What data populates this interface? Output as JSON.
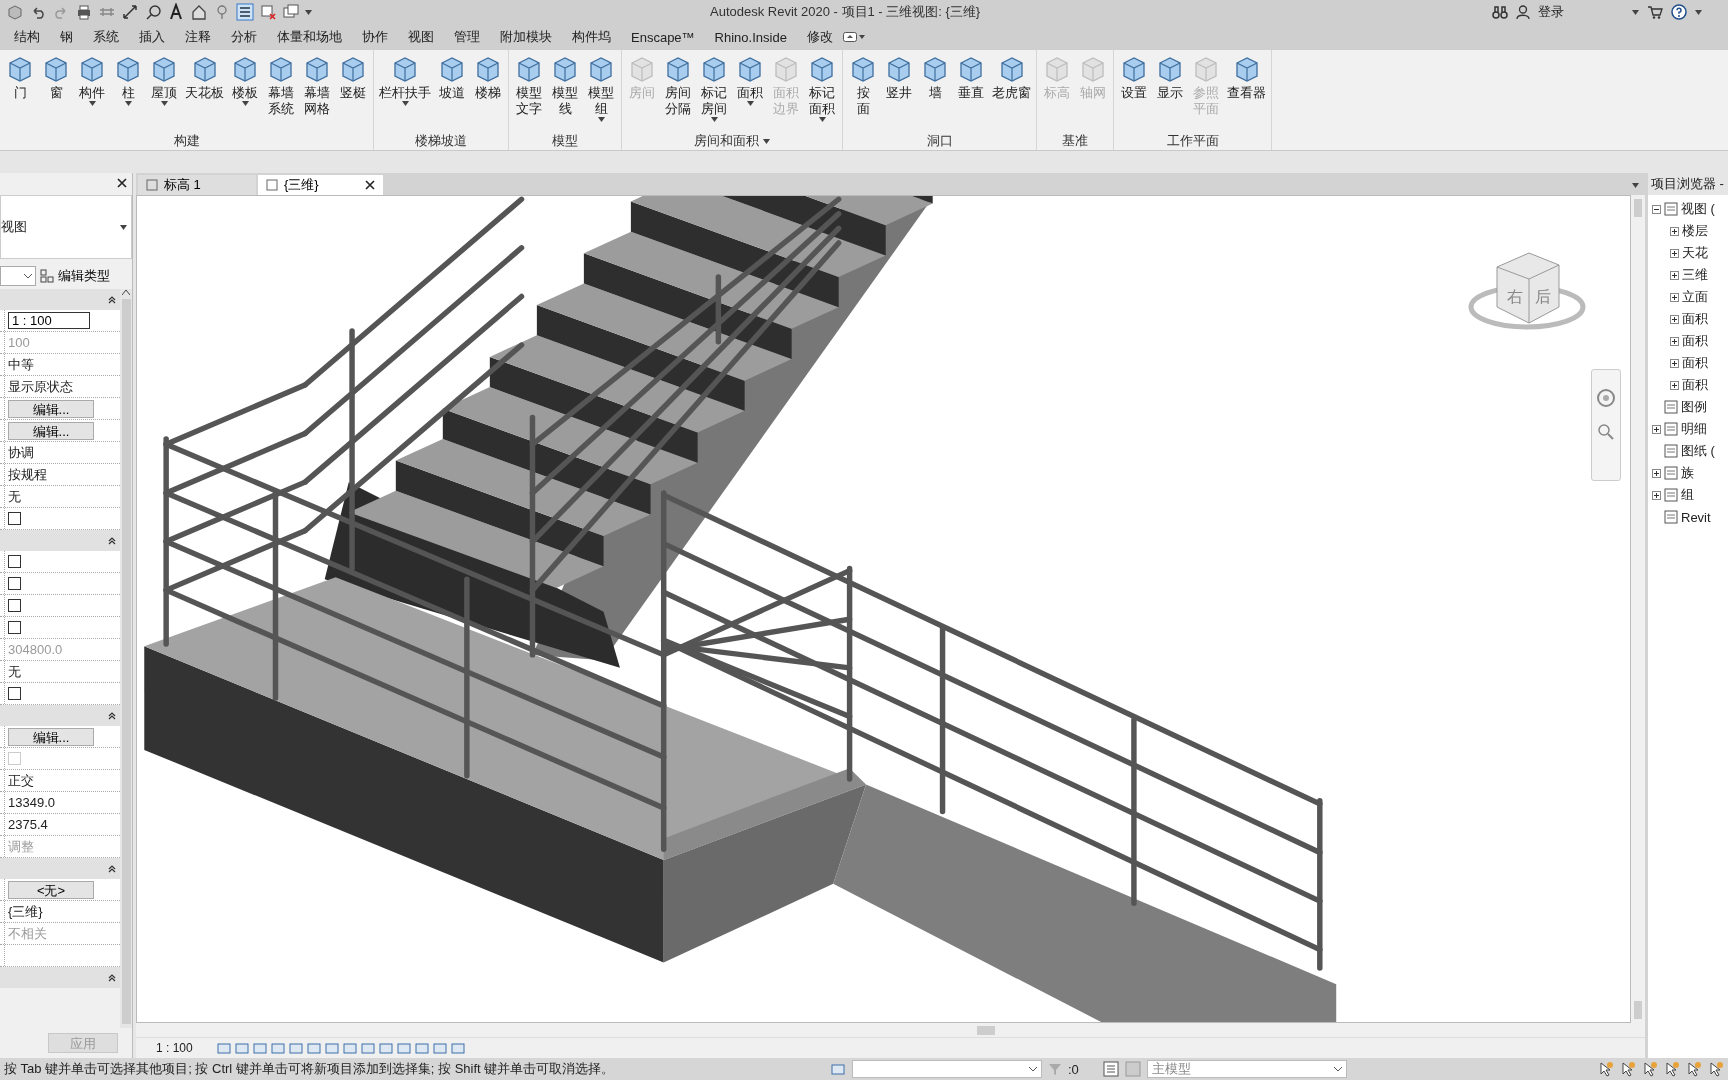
{
  "window": {
    "title": "Autodesk Revit 2020 - 项目1 - 三维视图: {三维}"
  },
  "account": {
    "label": "登录"
  },
  "ribbon_tabs": [
    {
      "label": "结构",
      "selected": false
    },
    {
      "label": "钢",
      "selected": false
    },
    {
      "label": "系统",
      "selected": false
    },
    {
      "label": "插入",
      "selected": false
    },
    {
      "label": "注释",
      "selected": false
    },
    {
      "label": "分析",
      "selected": false
    },
    {
      "label": "体量和场地",
      "selected": false
    },
    {
      "label": "协作",
      "selected": false
    },
    {
      "label": "视图",
      "selected": false
    },
    {
      "label": "管理",
      "selected": false
    },
    {
      "label": "附加模块",
      "selected": false
    },
    {
      "label": "构件坞",
      "selected": false
    },
    {
      "label": "Enscape™",
      "selected": false
    },
    {
      "label": "Rhino.Inside",
      "selected": false
    },
    {
      "label": "修改",
      "selected": false
    }
  ],
  "ribbon_panels": [
    {
      "title": "构建",
      "title_dropdown": false,
      "buttons": [
        {
          "lines": [
            "门"
          ],
          "disabled": false,
          "dropdown": false
        },
        {
          "lines": [
            "窗"
          ],
          "disabled": false,
          "dropdown": false
        },
        {
          "lines": [
            "构件"
          ],
          "disabled": false,
          "dropdown": true
        },
        {
          "lines": [
            "柱"
          ],
          "disabled": false,
          "dropdown": true
        },
        {
          "lines": [
            "屋顶"
          ],
          "disabled": false,
          "dropdown": true
        },
        {
          "lines": [
            "天花板"
          ],
          "disabled": false,
          "dropdown": false
        },
        {
          "lines": [
            "楼板"
          ],
          "disabled": false,
          "dropdown": true
        },
        {
          "lines": [
            "幕墙",
            "系统"
          ],
          "disabled": false,
          "dropdown": false
        },
        {
          "lines": [
            "幕墙",
            "网格"
          ],
          "disabled": false,
          "dropdown": false
        },
        {
          "lines": [
            "竖梃"
          ],
          "disabled": false,
          "dropdown": false
        }
      ]
    },
    {
      "title": "楼梯坡道",
      "title_dropdown": false,
      "buttons": [
        {
          "lines": [
            "栏杆扶手"
          ],
          "disabled": false,
          "dropdown": true
        },
        {
          "lines": [
            "坡道"
          ],
          "disabled": false,
          "dropdown": false
        },
        {
          "lines": [
            "楼梯"
          ],
          "disabled": false,
          "dropdown": false
        }
      ]
    },
    {
      "title": "模型",
      "title_dropdown": false,
      "buttons": [
        {
          "lines": [
            "模型",
            "文字"
          ],
          "disabled": false,
          "dropdown": false
        },
        {
          "lines": [
            "模型",
            "线"
          ],
          "disabled": false,
          "dropdown": false
        },
        {
          "lines": [
            "模型",
            "组"
          ],
          "disabled": false,
          "dropdown": true
        }
      ]
    },
    {
      "title": "房间和面积",
      "title_dropdown": true,
      "buttons": [
        {
          "lines": [
            "房间"
          ],
          "disabled": true,
          "dropdown": false
        },
        {
          "lines": [
            "房间",
            "分隔"
          ],
          "disabled": false,
          "dropdown": false
        },
        {
          "lines": [
            "标记",
            "房间"
          ],
          "disabled": false,
          "dropdown": true
        },
        {
          "lines": [
            "面积"
          ],
          "disabled": false,
          "dropdown": true
        },
        {
          "lines": [
            "面积",
            "边界"
          ],
          "disabled": true,
          "dropdown": false
        },
        {
          "lines": [
            "标记",
            "面积"
          ],
          "disabled": false,
          "dropdown": true
        }
      ]
    },
    {
      "title": "洞口",
      "title_dropdown": false,
      "buttons": [
        {
          "lines": [
            "按",
            "面"
          ],
          "disabled": false,
          "dropdown": false
        },
        {
          "lines": [
            "竖井"
          ],
          "disabled": false,
          "dropdown": false
        },
        {
          "lines": [
            "墙"
          ],
          "disabled": false,
          "dropdown": false
        },
        {
          "lines": [
            "垂直"
          ],
          "disabled": false,
          "dropdown": false
        },
        {
          "lines": [
            "老虎窗"
          ],
          "disabled": false,
          "dropdown": false
        }
      ]
    },
    {
      "title": "基准",
      "title_dropdown": false,
      "buttons": [
        {
          "lines": [
            "标高"
          ],
          "disabled": true,
          "dropdown": false
        },
        {
          "lines": [
            "轴网"
          ],
          "disabled": true,
          "dropdown": false
        }
      ]
    },
    {
      "title": "工作平面",
      "title_dropdown": false,
      "buttons": [
        {
          "lines": [
            "设置"
          ],
          "disabled": false,
          "dropdown": false
        },
        {
          "lines": [
            "显示"
          ],
          "disabled": false,
          "dropdown": false
        },
        {
          "lines": [
            "参照",
            "平面"
          ],
          "disabled": true,
          "dropdown": false
        },
        {
          "lines": [
            "查看器"
          ],
          "disabled": false,
          "dropdown": false
        }
      ]
    }
  ],
  "view_tabs": [
    {
      "label": "标高 1",
      "selected": false
    },
    {
      "label": "{三维}",
      "selected": true
    }
  ],
  "properties": {
    "type_name": "视图",
    "edit_type": "编辑类型",
    "apply": "应用",
    "rows": [
      {
        "kind": "section"
      },
      {
        "kind": "field",
        "value": "1 : 100"
      },
      {
        "kind": "text",
        "value": "100",
        "disabled": true
      },
      {
        "kind": "text",
        "value": "中等",
        "disabled": false
      },
      {
        "kind": "text",
        "value": "显示原状态",
        "disabled": false
      },
      {
        "kind": "button",
        "value": "编辑..."
      },
      {
        "kind": "button",
        "value": "编辑..."
      },
      {
        "kind": "text",
        "value": "协调",
        "disabled": false
      },
      {
        "kind": "text",
        "value": "按规程",
        "disabled": false
      },
      {
        "kind": "text",
        "value": "无",
        "disabled": false
      },
      {
        "kind": "checkbox",
        "checked": false,
        "disabled": false
      },
      {
        "kind": "section"
      },
      {
        "kind": "checkbox",
        "checked": false,
        "disabled": false
      },
      {
        "kind": "checkbox",
        "checked": false,
        "disabled": false
      },
      {
        "kind": "checkbox",
        "checked": false,
        "disabled": false
      },
      {
        "kind": "checkbox",
        "checked": false,
        "disabled": false
      },
      {
        "kind": "text",
        "value": "304800.0",
        "disabled": true
      },
      {
        "kind": "text",
        "value": "无",
        "disabled": false
      },
      {
        "kind": "checkbox",
        "checked": false,
        "disabled": false
      },
      {
        "kind": "section"
      },
      {
        "kind": "button",
        "value": "编辑..."
      },
      {
        "kind": "checkbox",
        "checked": false,
        "disabled": true
      },
      {
        "kind": "text",
        "value": "正交",
        "disabled": false
      },
      {
        "kind": "text",
        "value": "13349.0",
        "disabled": false
      },
      {
        "kind": "text",
        "value": "2375.4",
        "disabled": false
      },
      {
        "kind": "text",
        "value": "调整",
        "disabled": true
      },
      {
        "kind": "section"
      },
      {
        "kind": "button",
        "value": "<无>"
      },
      {
        "kind": "text",
        "value": "{三维}",
        "disabled": false
      },
      {
        "kind": "text",
        "value": "不相关",
        "disabled": true
      },
      {
        "kind": "blank"
      },
      {
        "kind": "section"
      }
    ]
  },
  "viewcube": {
    "faces": [
      "右",
      "后"
    ]
  },
  "view_control_bar": {
    "scale": "1 : 100"
  },
  "project_browser": {
    "title": "项目浏览器 -",
    "items": [
      {
        "label": "视图 (",
        "kind": "expanded",
        "children": [
          {
            "label": "楼层",
            "kind": "collapsed"
          },
          {
            "label": "天花",
            "kind": "collapsed"
          },
          {
            "label": "三维",
            "kind": "collapsed"
          },
          {
            "label": "立面",
            "kind": "collapsed"
          },
          {
            "label": "面积",
            "kind": "collapsed"
          },
          {
            "label": "面积",
            "kind": "collapsed"
          },
          {
            "label": "面积",
            "kind": "collapsed"
          },
          {
            "label": "面积",
            "kind": "collapsed"
          }
        ]
      },
      {
        "label": "图例",
        "kind": "leaf"
      },
      {
        "label": "明细",
        "kind": "collapsed"
      },
      {
        "label": "图纸 (",
        "kind": "leaf"
      },
      {
        "label": "族",
        "kind": "collapsed"
      },
      {
        "label": "组",
        "kind": "collapsed"
      },
      {
        "label": "Revit",
        "kind": "leaf"
      }
    ]
  },
  "status_bar": {
    "hint": "按 Tab 键并单击可选择其他项目; 按 Ctrl 键并单击可将新项目添加到选择集; 按 Shift 键并单击可取消选择。",
    "count": ":0",
    "model": "主模型"
  }
}
